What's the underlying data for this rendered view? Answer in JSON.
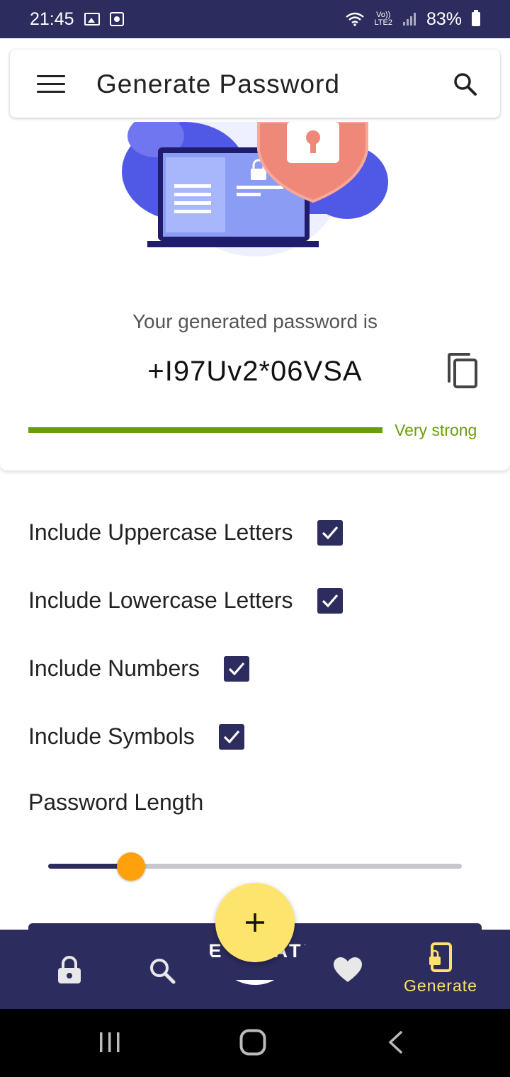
{
  "status_bar": {
    "time": "21:45",
    "network_line1": "Vo))",
    "network_line2": "LTE2",
    "battery": "83%"
  },
  "app_bar": {
    "title": "Generate Password",
    "menu_icon": "menu-icon",
    "search_icon": "search-icon"
  },
  "result": {
    "label": "Your generated password is",
    "password": "+I97Uv2*06VSA",
    "strength_label": "Very strong",
    "strength_fraction": 1.0,
    "strength_color": "#6a9e08"
  },
  "options": [
    {
      "label": "Include Uppercase Letters",
      "checked": true
    },
    {
      "label": "Include Lowercase Letters",
      "checked": true
    },
    {
      "label": "Include Numbers",
      "checked": true
    },
    {
      "label": "Include Symbols",
      "checked": true
    }
  ],
  "length": {
    "label": "Password Length",
    "slider_fraction": 0.2
  },
  "generate_button": {
    "label_left": "GE",
    "label_right": "ATE"
  },
  "bottom_nav": {
    "items": [
      {
        "icon": "lock-icon"
      },
      {
        "icon": "search-icon"
      },
      {
        "icon": "heart-icon"
      },
      {
        "icon": "phone-lock-icon",
        "label": "Generate",
        "active": true
      }
    ],
    "fab_icon": "plus-icon"
  },
  "colors": {
    "primary": "#2d2c5e",
    "accent": "#fde56d",
    "slider_thumb": "#ffa10a"
  }
}
